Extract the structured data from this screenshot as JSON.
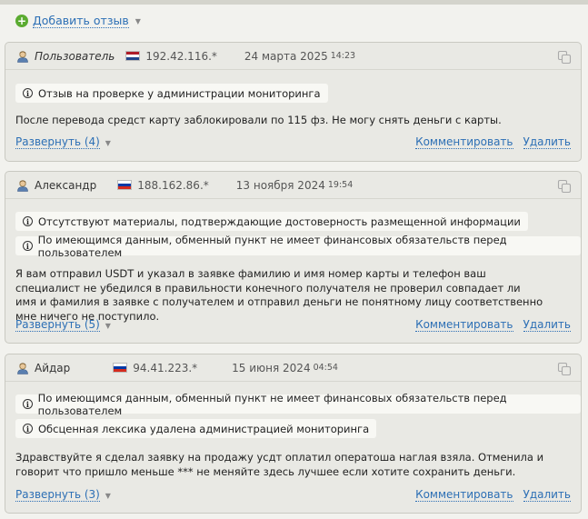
{
  "add_review": {
    "label": "Добавить отзыв"
  },
  "reviews": [
    {
      "author": "Пользователь",
      "ip": "192.42.116.*",
      "date": "24 марта 2025",
      "time": "14:23",
      "notices": [
        "Отзыв на проверке у администрации мониторинга"
      ],
      "text": "После перевода средст карту заблокировали по 115 фз. Не могу снять деньги с карты.",
      "expand": "Развернуть (4)",
      "comment": "Комментировать",
      "delete": "Удалить"
    },
    {
      "author": "Александр",
      "ip": "188.162.86.*",
      "date": "13 ноября 2024",
      "time": "19:54",
      "notices": [
        "Отсутствуют материалы, подтверждающие достоверность размещенной информации",
        "По имеющимся данным, обменный пункт не имеет финансовых обязательств перед пользователем"
      ],
      "text": "Я вам отправил USDT и указал в заявке фамилию и имя номер карты и телефон ваш специалист не убедился в правильности конечного получателя не проверил совпадает ли имя и фамилия в заявке с получателем и отправил деньги не понятному лицу соответственно мне ничего не поступило.",
      "expand": "Развернуть (5)",
      "comment": "Комментировать",
      "delete": "Удалить"
    },
    {
      "author": "Айдар",
      "ip": "94.41.223.*",
      "date": "15 июня 2024",
      "time": "04:54",
      "notices": [
        "По имеющимся данным, обменный пункт не имеет финансовых обязательств перед пользователем",
        "Обсценная лексика удалена администрацией мониторинга"
      ],
      "text": "Здравствуйте я сделал заявку на продажу усдт оплатил оператоша наглая взяла. Отменила и говорит что пришло меньше *** не меняйте здесь лучшее если хотите сохранить деньги.",
      "expand": "Развернуть (3)",
      "comment": "Комментировать",
      "delete": "Удалить"
    }
  ]
}
